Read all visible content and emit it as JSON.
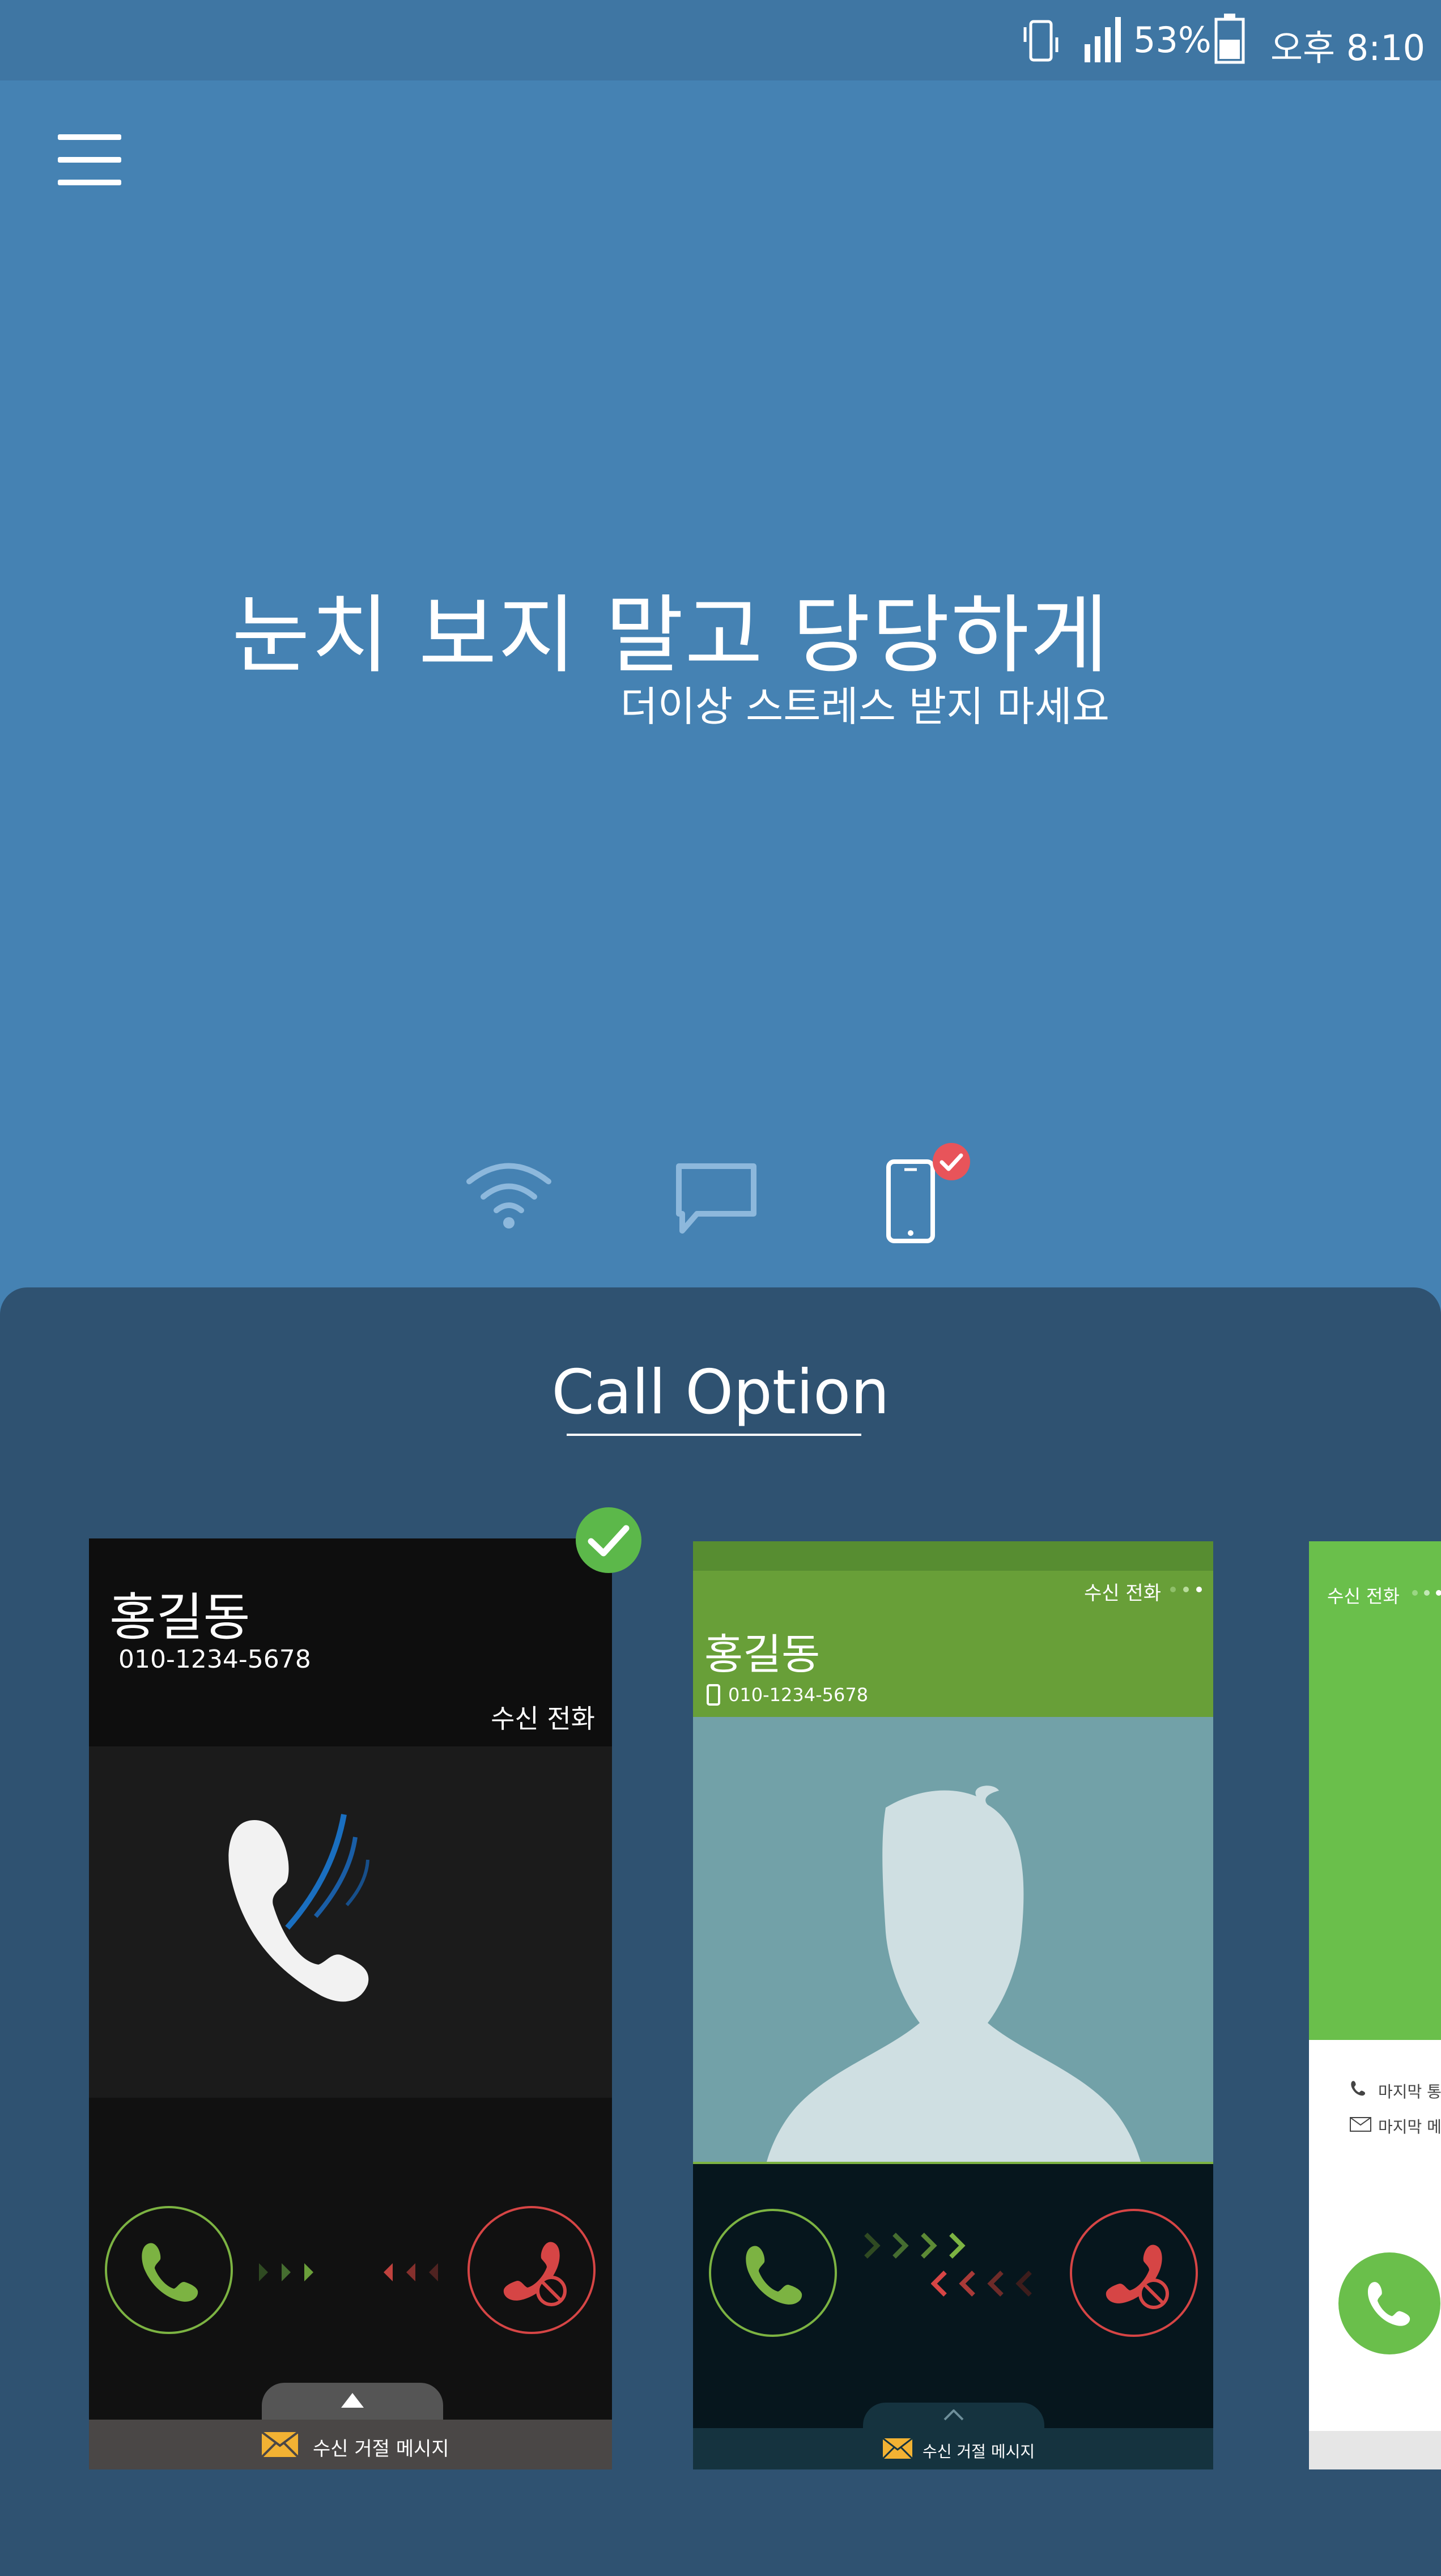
{
  "status_bar": {
    "battery_percent": "53%",
    "time": "오후 8:10",
    "icons": [
      "phone-vibrate-icon",
      "signal-icon",
      "battery-icon"
    ]
  },
  "hero": {
    "title": "눈치 보지 말고 당당하게",
    "subtitle": "더이상 스트레스 받지 마세요",
    "mode_icons": [
      "wifi-icon",
      "message-icon",
      "phone-icon"
    ],
    "selected_mode": "phone-icon"
  },
  "call_option": {
    "title": "Call Option",
    "cards": [
      {
        "name": "홍길동",
        "number": "010-1234-5678",
        "status": "수신 전화",
        "reject_message": "수신 거절 메시지",
        "selected": true
      },
      {
        "name": "홍길동",
        "number": "010-1234-5678",
        "status": "수신 전화",
        "reject_message": "수신 거절 메시지",
        "selected": false
      },
      {
        "status": "수신 전화",
        "last_call": "마지막 통",
        "last_message": "마지막 메",
        "selected": false
      }
    ]
  },
  "colors": {
    "hero_bg": "#4582b3",
    "status_bg": "#3f76a3",
    "panel_bg": "#2f5271",
    "accept_green": "#7cb342",
    "reject_red": "#d64545",
    "check_green": "#5cb84a",
    "badge_red": "#e8545a"
  }
}
